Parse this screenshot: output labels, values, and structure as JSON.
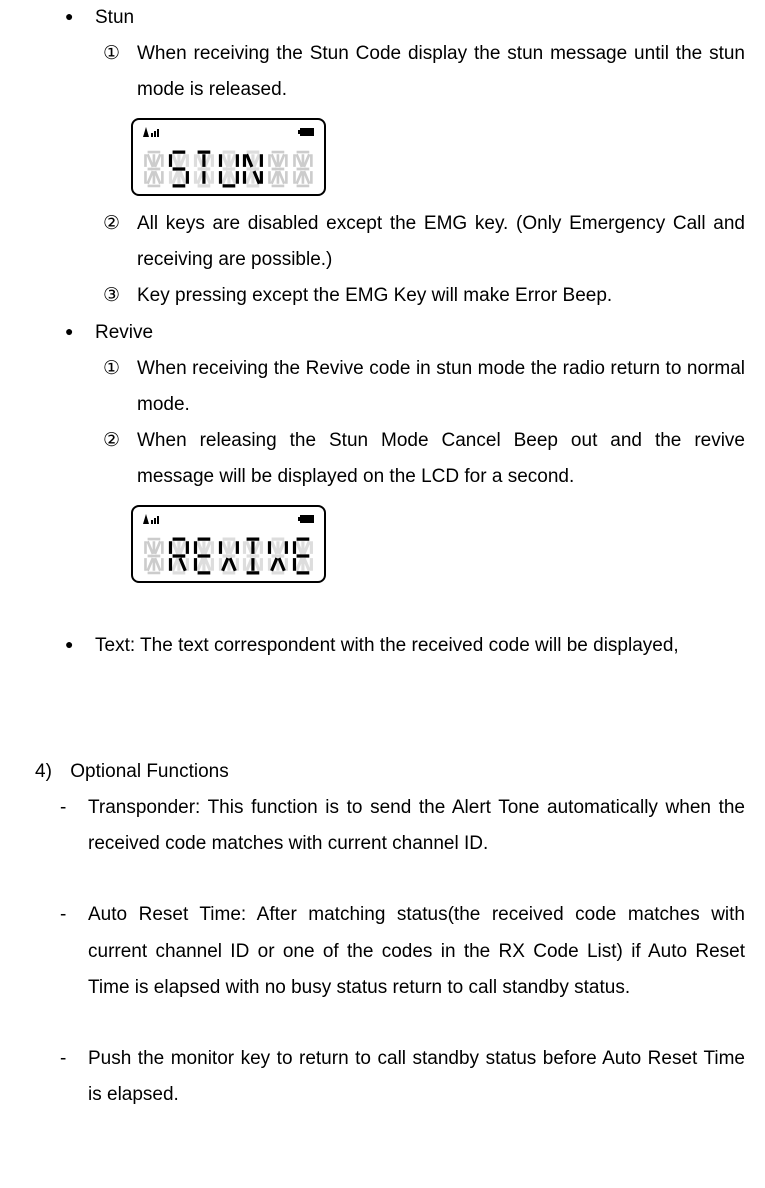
{
  "stun": {
    "label": "Stun",
    "items": [
      "When receiving the Stun Code display the stun message until the stun mode is released.",
      "All keys are disabled except the EMG key. (Only Emergency Call and receiving are possible.)",
      "Key pressing except the EMG Key will make Error Beep."
    ]
  },
  "revive": {
    "label": "Revive",
    "items": [
      "When receiving the Revive code in stun mode the radio return to normal mode.",
      "When releasing the Stun Mode Cancel Beep out and the revive message will be displayed on the LCD for a second."
    ]
  },
  "text_bullet": {
    "text": "Text: The text correspondent with the received code will be displayed,"
  },
  "section4": {
    "num": "4)",
    "title": "Optional Functions",
    "items": [
      "Transponder: This function is to send the Alert Tone automatically when the received code matches with current channel ID.",
      "Auto Reset Time: After matching status(the received code matches with current channel ID or one of the codes in the RX Code List) if Auto Reset Time is elapsed with no busy status return to call standby status.",
      "Push the monitor key to return to call standby status before Auto Reset Time is elapsed."
    ]
  },
  "lcd_stun": "STUN",
  "lcd_revive": "REVIVE"
}
